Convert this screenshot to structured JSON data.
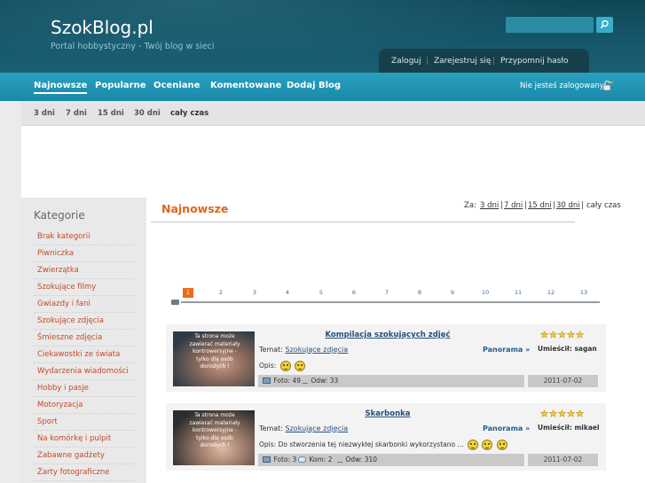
{
  "site": {
    "title": "SzokBlog.pl",
    "tagline": "Portal hobbystyczny - Twój blog w sieci"
  },
  "search": {
    "placeholder": ""
  },
  "auth": {
    "login": "Zaloguj",
    "register": "Zarejestruj się",
    "remind": "Przypomnij hasło"
  },
  "nav": {
    "items": [
      {
        "label": "Najnowsze"
      },
      {
        "label": "Popularne"
      },
      {
        "label": "Oceniane"
      },
      {
        "label": "Komentowane"
      },
      {
        "label": "Dodaj Blog"
      }
    ],
    "login_status": "Nie jesteś zalogowany"
  },
  "subnav": {
    "items": [
      {
        "label": "3 dni"
      },
      {
        "label": "7 dni"
      },
      {
        "label": "15 dni"
      },
      {
        "label": "30 dni"
      },
      {
        "label": "cały czas"
      }
    ]
  },
  "sidebar": {
    "title": "Kategorie",
    "items": [
      {
        "label": "Brak kategorii"
      },
      {
        "label": "Piwniczka"
      },
      {
        "label": "Zwierzątka"
      },
      {
        "label": "Szokujące filmy"
      },
      {
        "label": "Gwiazdy i fani"
      },
      {
        "label": "Szokujące zdjęcia"
      },
      {
        "label": "Śmieszne zdjęcia"
      },
      {
        "label": "Ciekawostki ze świata"
      },
      {
        "label": "Wydarzenia wiadomości"
      },
      {
        "label": "Hobby i pasje"
      },
      {
        "label": "Motoryzacja"
      },
      {
        "label": "Sport"
      },
      {
        "label": "Na komórkę i pulpit"
      },
      {
        "label": "Zabawne gadżety"
      },
      {
        "label": "Żarty fotograficzne"
      }
    ]
  },
  "main": {
    "title": "Najnowsze",
    "period_label": "Za:",
    "periods": [
      "3 dni",
      "7 dni",
      "15 dni",
      "30 dni"
    ],
    "period_sep": "|",
    "period_all": "cały czas",
    "pages": [
      "1",
      "2",
      "3",
      "4",
      "5",
      "6",
      "7",
      "8",
      "9",
      "10",
      "11",
      "12",
      "13"
    ],
    "current_page": "1"
  },
  "entries": [
    {
      "title": "Kompilacja szokujących zdjęć",
      "topic_label": "Temat:",
      "topic": "Szokujące zdjęcia",
      "panorama": "Panorama »",
      "author_label": "Umieścił:",
      "author": "sagan",
      "desc_label": "Opis:",
      "desc": "",
      "photos": "Foto: 49",
      "comments": "",
      "views": "Odw: 33",
      "date": "2011-07-02",
      "rating_stars": 5,
      "thumb_warning": "Ta strona może zawierać materiały kontrowersyjne - tylko dla osób dorosłych !"
    },
    {
      "title": "Skarbonka",
      "topic_label": "Temat:",
      "topic": "Szokujące zdjęcia",
      "panorama": "Panorama »",
      "author_label": "Umieścił:",
      "author": "mikael",
      "desc_label": "Opis:",
      "desc": "Do stworzenia tej niezwykłej skarbonki wykorzystano ...",
      "photos": "Foto: 3",
      "comments": "Kom: 2",
      "views": "Odw: 310",
      "date": "2011-07-02",
      "rating_stars": 5,
      "thumb_warning": "Ta strona może zawierać materiały kontrowersyjne - tylko dla osób dorosłych !"
    }
  ],
  "colors": {
    "header": "#16566a",
    "nav": "#1e91b0",
    "accent": "#e0661a",
    "link": "#254f7c",
    "category": "#c24b2a"
  }
}
